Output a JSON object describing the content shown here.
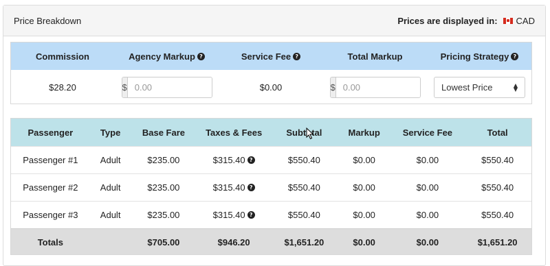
{
  "panel": {
    "title": "Price Breakdown",
    "currency_label": "Prices are displayed in:",
    "currency_code": "CAD"
  },
  "markup": {
    "headers": [
      "Commission",
      "Agency Markup",
      "Service Fee",
      "Total Markup",
      "Pricing Strategy"
    ],
    "commission": "$28.20",
    "agency_markup": {
      "addon": "$",
      "placeholder": "0.00"
    },
    "service_fee": "$0.00",
    "total_markup": {
      "addon": "$",
      "placeholder": "0.00"
    },
    "pricing_strategy": "Lowest Price"
  },
  "passengers": {
    "headers": [
      "Passenger",
      "Type",
      "Base Fare",
      "Taxes & Fees",
      "Subtotal",
      "Markup",
      "Service Fee",
      "Total"
    ],
    "rows": [
      [
        "Passenger #1",
        "Adult",
        "$235.00",
        "$315.40",
        "$550.40",
        "$0.00",
        "$0.00",
        "$550.40"
      ],
      [
        "Passenger #2",
        "Adult",
        "$235.00",
        "$315.40",
        "$550.40",
        "$0.00",
        "$0.00",
        "$550.40"
      ],
      [
        "Passenger #3",
        "Adult",
        "$235.00",
        "$315.40",
        "$550.40",
        "$0.00",
        "$0.00",
        "$550.40"
      ]
    ],
    "totals": [
      "Totals",
      "",
      "$705.00",
      "$946.20",
      "$1,651.20",
      "$0.00",
      "$0.00",
      "$1,651.20"
    ]
  },
  "icons": {
    "help": "?"
  },
  "colors": {
    "markup_header": "#bcdcf7",
    "passenger_header": "#bde2e9",
    "totals_row": "#dddddd"
  }
}
